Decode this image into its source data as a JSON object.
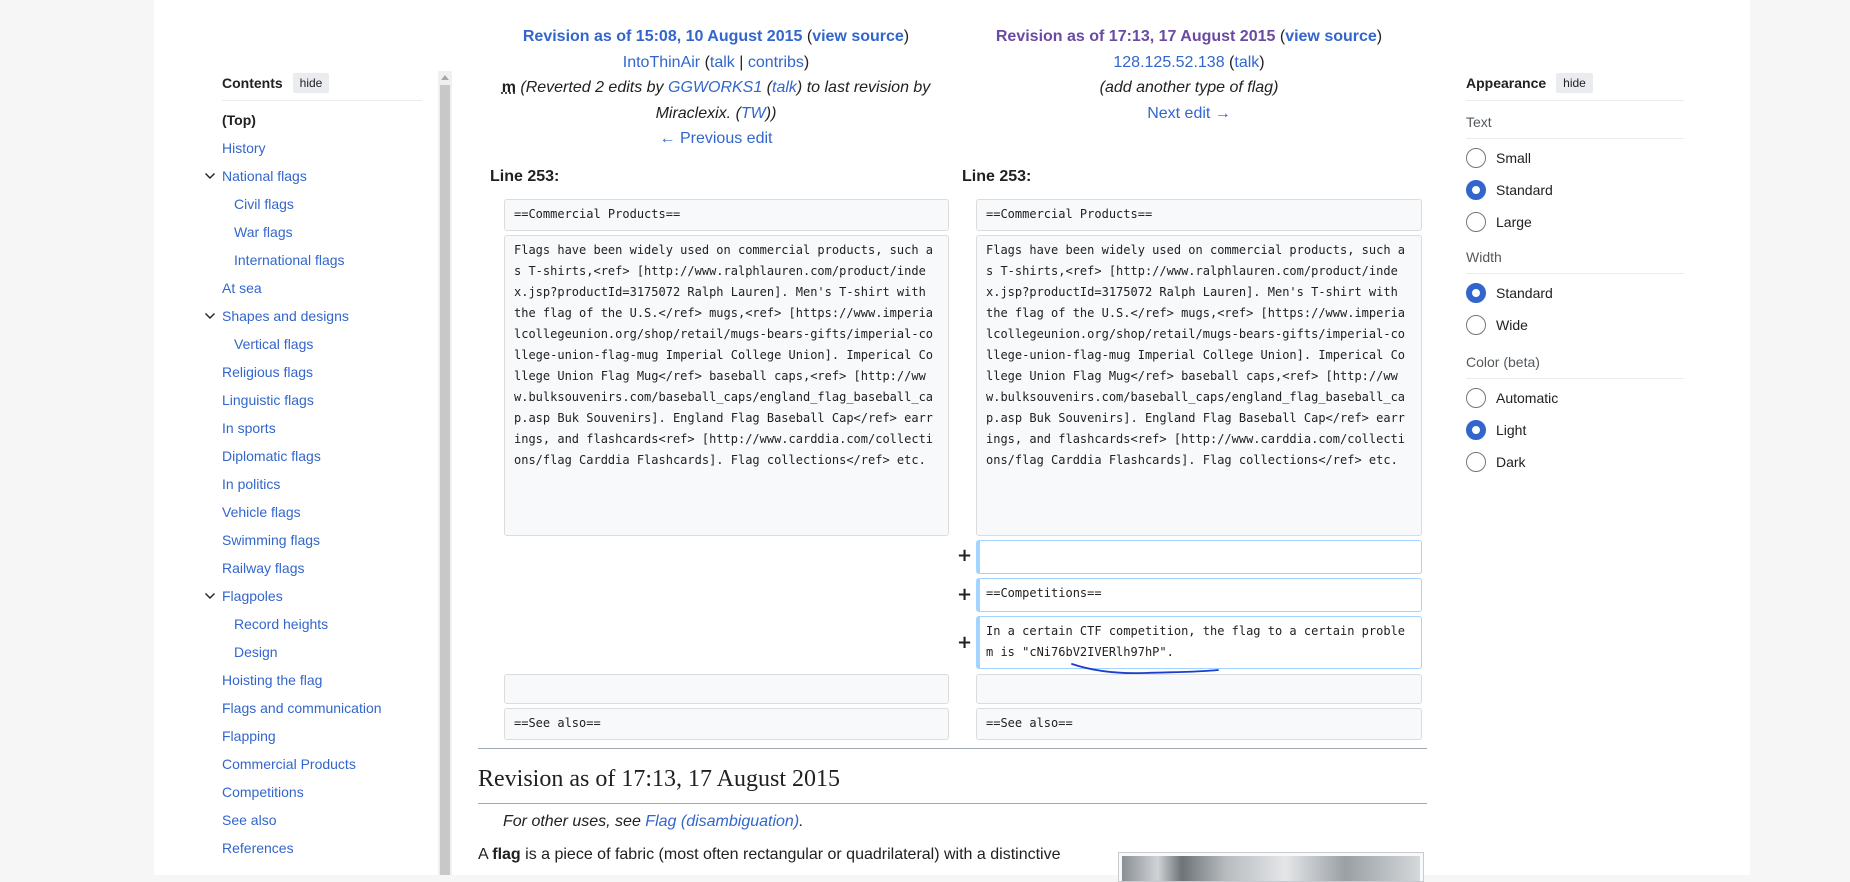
{
  "toc": {
    "title": "Contents",
    "hide_label": "hide",
    "items": [
      {
        "label": "(Top)",
        "level": 0,
        "top": true
      },
      {
        "label": "History",
        "level": 0
      },
      {
        "label": "National flags",
        "level": 0,
        "expanded": true
      },
      {
        "label": "Civil flags",
        "level": 1
      },
      {
        "label": "War flags",
        "level": 1
      },
      {
        "label": "International flags",
        "level": 1
      },
      {
        "label": "At sea",
        "level": 0
      },
      {
        "label": "Shapes and designs",
        "level": 0,
        "expanded": true
      },
      {
        "label": "Vertical flags",
        "level": 1
      },
      {
        "label": "Religious flags",
        "level": 0
      },
      {
        "label": "Linguistic flags",
        "level": 0
      },
      {
        "label": "In sports",
        "level": 0
      },
      {
        "label": "Diplomatic flags",
        "level": 0
      },
      {
        "label": "In politics",
        "level": 0
      },
      {
        "label": "Vehicle flags",
        "level": 0
      },
      {
        "label": "Swimming flags",
        "level": 0
      },
      {
        "label": "Railway flags",
        "level": 0
      },
      {
        "label": "Flagpoles",
        "level": 0,
        "expanded": true
      },
      {
        "label": "Record heights",
        "level": 1
      },
      {
        "label": "Design",
        "level": 1
      },
      {
        "label": "Hoisting the flag",
        "level": 0
      },
      {
        "label": "Flags and communication",
        "level": 0
      },
      {
        "label": "Flapping",
        "level": 0
      },
      {
        "label": "Commercial Products",
        "level": 0
      },
      {
        "label": "Competitions",
        "level": 0
      },
      {
        "label": "See also",
        "level": 0
      },
      {
        "label": "References",
        "level": 0
      }
    ]
  },
  "diff": {
    "left": {
      "title": "Revision as of 15:08, 10 August 2015",
      "view_source": "view source",
      "user": "IntoThinAir",
      "talk": "talk",
      "separator": "|",
      "contribs": "contribs",
      "minor": "m",
      "summary_prefix": "(Reverted 2 edits by ",
      "summary_user": "GGWORKS1",
      "summary_talk": "talk",
      "summary_suffix": ") to last revision by Miraclexix. (",
      "summary_tw": "TW",
      "summary_end": "))",
      "nav": "← Previous edit"
    },
    "right": {
      "title": "Revision as of 17:13, 17 August 2015",
      "view_source": "view source",
      "user": "128.125.52.138",
      "talk": "talk",
      "summary": "(add another type of flag)",
      "nav": "Next edit →"
    },
    "line_label": "Line 253:",
    "context_header": "==Commercial Products==",
    "context_body": "Flags have been widely used on commercial products, such as T-shirts,<ref> [http://www.ralphlauren.com/product/index.jsp?productId=3175072 Ralph Lauren]. Men's T-shirt with the flag of the U.S.</ref> mugs,<ref> [https://www.imperialcollegeunion.org/shop/retail/mugs-bears-gifts/imperial-college-union-flag-mug Imperial College Union]. Imperical College Union Flag Mug</ref> baseball caps,<ref> [http://www.bulksouvenirs.com/baseball_caps/england_flag_baseball_cap.asp Buk Souvenirs]. England Flag Baseball Cap</ref> earrings, and flashcards<ref> [http://www.carddia.com/collections/flag Carddia Flashcards]. Flag collections</ref> etc.",
    "added_blank": "",
    "added_header": "==Competitions==",
    "added_body": "In a certain CTF competition, the flag to a certain problem is \"cNi76bV2IVERlh97hP\".",
    "plus_sign": "+",
    "see_also": "==See also=="
  },
  "article": {
    "title": "Revision as of 17:13, 17 August 2015",
    "hatnote_prefix": "For other uses, see ",
    "hatnote_link": "Flag (disambiguation)",
    "hatnote_suffix": ".",
    "para_prefix": "A ",
    "para_bold": "flag",
    "para_rest": " is a piece of fabric (most often rectangular or quadrilateral) with a distinctive"
  },
  "appearance": {
    "title": "Appearance",
    "hide_label": "hide",
    "text_label": "Text",
    "text_options": [
      "Small",
      "Standard",
      "Large"
    ],
    "text_selected": "Standard",
    "width_label": "Width",
    "width_options": [
      "Standard",
      "Wide"
    ],
    "width_selected": "Standard",
    "color_label": "Color (beta)",
    "color_options": [
      "Automatic",
      "Light",
      "Dark"
    ],
    "color_selected": "Light"
  },
  "colors": {
    "link": "#3366cc",
    "visited": "#6b4ba1",
    "added_border": "#a3d3ff",
    "annotation_ink": "#1a3fcf"
  }
}
